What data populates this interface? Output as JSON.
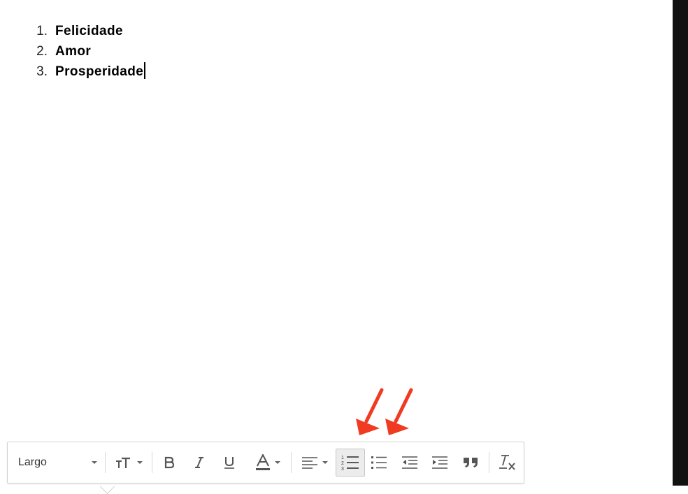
{
  "document": {
    "list": [
      {
        "number": "1.",
        "text": "Felicidade"
      },
      {
        "number": "2.",
        "text": "Amor"
      },
      {
        "number": "3.",
        "text": "Prosperidade"
      }
    ]
  },
  "toolbar": {
    "font_family": "Largo",
    "buttons": [
      {
        "name": "font-size-button",
        "icon": "text-size-icon",
        "letter": "TT"
      },
      {
        "name": "bold-button",
        "icon": "bold-icon",
        "letter": "B"
      },
      {
        "name": "italic-button",
        "icon": "italic-icon",
        "letter": "I"
      },
      {
        "name": "underline-button",
        "icon": "underline-icon",
        "letter": "U"
      },
      {
        "name": "text-color-button",
        "icon": "text-color-icon",
        "letter": "A"
      },
      {
        "name": "align-button",
        "icon": "align-left-icon"
      },
      {
        "name": "numbered-list-button",
        "icon": "numbered-list-icon",
        "active": true
      },
      {
        "name": "bulleted-list-button",
        "icon": "bulleted-list-icon"
      },
      {
        "name": "indent-less-button",
        "icon": "indent-less-icon"
      },
      {
        "name": "indent-more-button",
        "icon": "indent-more-icon"
      },
      {
        "name": "quote-button",
        "icon": "quote-icon"
      },
      {
        "name": "remove-formatting-button",
        "icon": "remove-formatting-icon",
        "letter": "T"
      }
    ]
  },
  "annotations": {
    "arrow_color": "#f03a21"
  }
}
